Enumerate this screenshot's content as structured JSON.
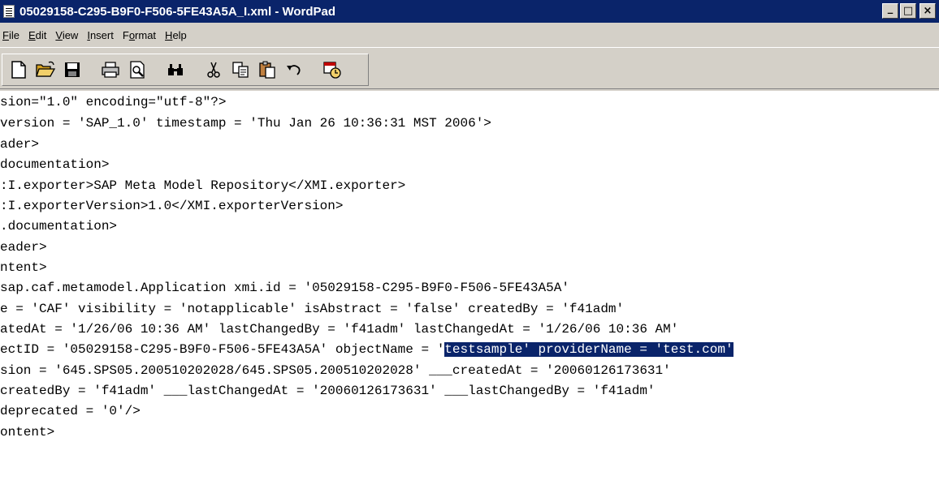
{
  "window": {
    "title": "05029158-C295-B9F0-F506-5FE43A5A_I.xml - WordPad",
    "minimize": "_",
    "maximize": "□",
    "close": "×"
  },
  "menubar": {
    "items": [
      {
        "mnemonic": "F",
        "rest": "ile"
      },
      {
        "mnemonic": "E",
        "rest": "dit"
      },
      {
        "mnemonic": "V",
        "rest": "iew"
      },
      {
        "mnemonic": "I",
        "rest": "nsert"
      },
      {
        "pre": "F",
        "mnemonic": "o",
        "rest": "rmat"
      },
      {
        "mnemonic": "H",
        "rest": "elp"
      }
    ]
  },
  "toolbar": {
    "icons": [
      "new-icon",
      "open-icon",
      "save-icon",
      "print-icon",
      "print-preview-icon",
      "find-icon",
      "cut-icon",
      "copy-icon",
      "paste-icon",
      "undo-icon",
      "insert-datetime-icon"
    ]
  },
  "document": {
    "lines": [
      "sion=\"1.0\" encoding=\"utf-8\"?>",
      "version = 'SAP_1.0' timestamp = 'Thu Jan 26 10:36:31 MST 2006'>",
      "ader>",
      "documentation>",
      ":I.exporter>SAP Meta Model Repository</XMI.exporter>",
      ":I.exporterVersion>1.0</XMI.exporterVersion>",
      ".documentation>",
      "eader>",
      "ntent>",
      "sap.caf.metamodel.Application xmi.id = '05029158-C295-B9F0-F506-5FE43A5A'",
      "e = 'CAF' visibility = 'notapplicable' isAbstract = 'false' createdBy = 'f41adm'",
      "atedAt = '1/26/06 10:36 AM' lastChangedBy = 'f41adm' lastChangedAt = '1/26/06 10:36 AM'",
      "ectID = '05029158-C295-B9F0-F506-5FE43A5A' objectName = '",
      "sion = '645.SPS05.200510202028/645.SPS05.200510202028' ___createdAt = '20060126173631'",
      "createdBy = 'f41adm' ___lastChangedAt = '20060126173631' ___lastChangedBy = 'f41adm'",
      "deprecated = '0'/>",
      "ontent>"
    ],
    "selected_text": "testsample' providerName = 'test.com'"
  },
  "colors": {
    "titlebar": "#0a246a",
    "selection": "#0a246a",
    "chrome": "#d4d0c8"
  }
}
